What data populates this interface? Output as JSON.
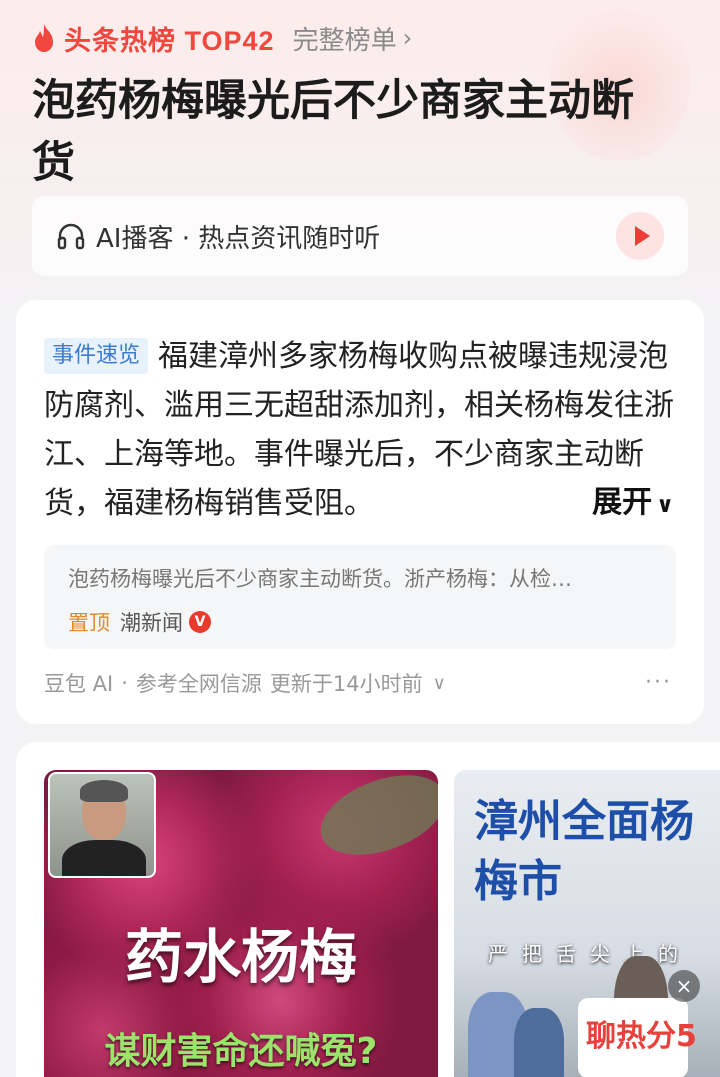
{
  "header": {
    "rank_label": "头条热榜 TOP42",
    "full_list_label": "完整榜单",
    "title": "泡药杨梅曝光后不少商家主动断货"
  },
  "podcast": {
    "label": "AI播客 · 热点资讯随时听"
  },
  "summary_card": {
    "tag": "事件速览",
    "text": "福建漳州多家杨梅收购点被曝违规浸泡防腐剂、滥用三无超甜添加剂，相关杨梅发往浙江、上海等地。事件曝光后，不少商家主动断货，福建杨梅销售受阻。",
    "expand_label": "展开",
    "source": {
      "title": "泡药杨梅曝光后不少商家主动断货。浙产杨梅：从检…",
      "pin_label": "置顶",
      "publisher": "潮新闻",
      "badge": "V"
    },
    "footer": {
      "ai_source": "豆包 AI",
      "reference": "参考全网信源",
      "updated": "更新于14小时前"
    }
  },
  "media": {
    "image1": {
      "caption": "药水杨梅",
      "subcaption": "谋财害命还喊冤?"
    },
    "image2": {
      "banner": "漳州全面杨梅市",
      "strip": "严把舌尖上的",
      "sign": "聊热分5"
    }
  },
  "colors": {
    "accent": "#f0483e",
    "tag_blue": "#3d7bd1",
    "pin_orange": "#e08a2a"
  }
}
